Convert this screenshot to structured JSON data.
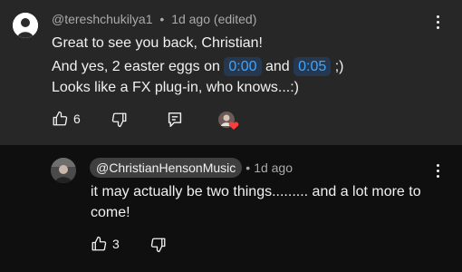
{
  "comment": {
    "author": "@tereshchukilya1",
    "time": "1d ago",
    "edited": "(edited)",
    "line1": "Great to see you back, Christian!",
    "line2_prefix": "And yes, 2 easter eggs on",
    "timestamp1": "0:00",
    "line2_mid": "and",
    "timestamp2": "0:05",
    "line2_suffix": ";)",
    "line3": "Looks like a FX plug-in, who knows...:)",
    "likes": "6"
  },
  "reply": {
    "author": "@ChristianHensonMusic",
    "time": "1d ago",
    "text": "it may actually be two things......... and a lot more to come!",
    "likes": "3"
  },
  "colors": {
    "comment_bg": "#272727",
    "page_bg": "#0f0f0f",
    "timestamp_link": "#3ea6ff",
    "heart": "#ff3b3b"
  },
  "icons": {
    "like": "thumbs-up-icon",
    "dislike": "thumbs-down-icon",
    "reply": "reply-icon",
    "more": "more-vert-icon",
    "creator_heart": "creator-heart-icon"
  }
}
